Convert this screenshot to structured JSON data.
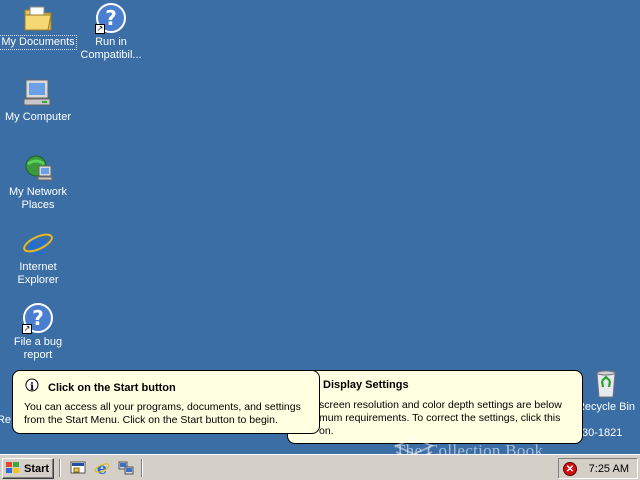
{
  "desktop": {
    "background": "#3A6EA5",
    "icons": [
      {
        "label": "My Documents",
        "icon": "folder-documents-icon"
      },
      {
        "label": "Run in Compatibil...",
        "icon": "help-shortcut-icon"
      },
      {
        "label": "My Computer",
        "icon": "computer-icon"
      },
      {
        "label": "My Network Places",
        "icon": "network-places-icon"
      },
      {
        "label": "Internet Explorer",
        "icon": "internet-explorer-icon"
      },
      {
        "label": "File a bug report",
        "icon": "help-shortcut-icon"
      },
      {
        "label": "Recycle Bin",
        "icon": "recycle-bin-icon"
      },
      {
        "label": "Re",
        "icon": "partial-icon"
      }
    ],
    "recycle_bin_overlay": "30-1821"
  },
  "balloon_start": {
    "title": "Click on the Start button",
    "body": "You can access all your programs, documents, and settings from the Start Menu. Click on the Start button to begin."
  },
  "balloon_display": {
    "title": "Display Settings",
    "body_line1": "screen resolution and color depth settings are below",
    "body_line2": "mum requirements. To correct the settings, click this",
    "body_line3": "on."
  },
  "taskbar": {
    "start_label": "Start",
    "clock": "7:25 AM",
    "quick_launch": [
      "show-desktop-icon",
      "internet-explorer-icon",
      "network-icon"
    ],
    "tray_icons": [
      "error-icon"
    ]
  },
  "watermark": "The Collection Book"
}
